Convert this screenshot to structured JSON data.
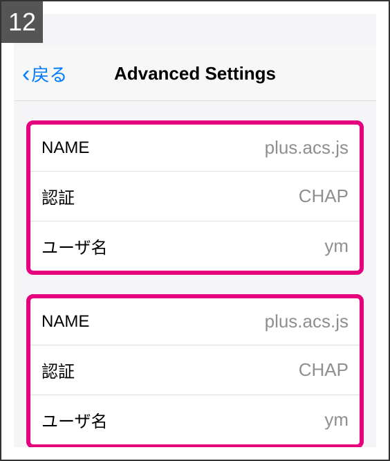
{
  "step": "12",
  "nav": {
    "back_label": "戻る",
    "title": "Advanced Settings"
  },
  "sections": [
    {
      "rows": [
        {
          "label": "NAME",
          "value": "plus.acs.js"
        },
        {
          "label": "認証",
          "value": "CHAP"
        },
        {
          "label": "ユーザ名",
          "value": "ym"
        }
      ]
    },
    {
      "rows": [
        {
          "label": "NAME",
          "value": "plus.acs.js"
        },
        {
          "label": "認証",
          "value": "CHAP"
        },
        {
          "label": "ユーザ名",
          "value": "ym"
        }
      ]
    }
  ]
}
